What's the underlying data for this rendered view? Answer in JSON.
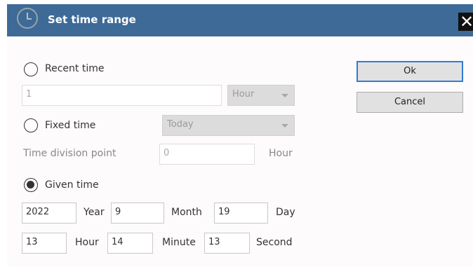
{
  "dialog": {
    "title": "Set time range",
    "close_label": "✕"
  },
  "recent": {
    "label": "Recent time",
    "value": "1",
    "unit_selected": "Hour"
  },
  "fixed": {
    "label": "Fixed time",
    "selected": "Today"
  },
  "division": {
    "label": "Time division point",
    "value": "0",
    "unit": "Hour"
  },
  "given": {
    "label": "Given time",
    "year": "2022",
    "year_label": "Year",
    "month": "9",
    "month_label": "Month",
    "day": "19",
    "day_label": "Day",
    "hour": "13",
    "hour_label": "Hour",
    "minute": "14",
    "minute_label": "Minute",
    "second": "13",
    "second_label": "Second"
  },
  "buttons": {
    "ok": "Ok",
    "cancel": "Cancel"
  },
  "selected_mode": "Given time",
  "colors": {
    "titlebar": "#3d6a96",
    "primary_border": "#2f7cd6"
  }
}
